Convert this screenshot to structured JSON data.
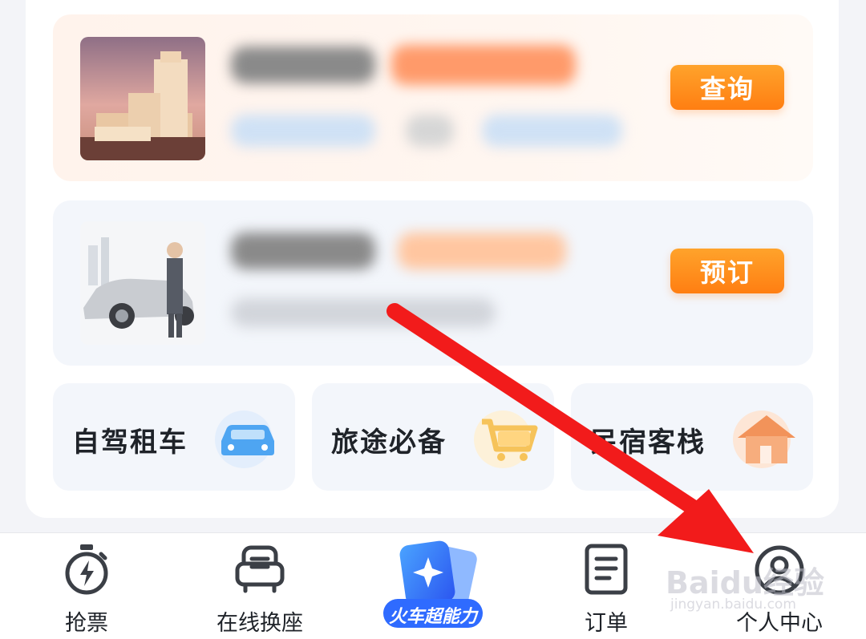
{
  "cards": {
    "hotel": {
      "button_label": "查询"
    },
    "car_service": {
      "button_label": "预订"
    }
  },
  "quick_tiles": [
    {
      "label": "自驾租车",
      "icon": "car-icon"
    },
    {
      "label": "旅途必备",
      "icon": "shopping-cart-icon"
    },
    {
      "label": "民宿客栈",
      "icon": "house-icon"
    }
  ],
  "tabbar": {
    "items": [
      {
        "label": "抢票",
        "icon": "stopwatch-lightning-icon"
      },
      {
        "label": "在线换座",
        "icon": "seat-icon"
      },
      {
        "label": "火车超能力",
        "icon": "star-cards-icon"
      },
      {
        "label": "订单",
        "icon": "document-icon"
      },
      {
        "label": "个人中心",
        "icon": "user-icon"
      }
    ]
  },
  "watermark": {
    "brand": "Baidu经验",
    "url": "jingyan.baidu.com"
  },
  "colors": {
    "accent_orange": "#ff8a1c",
    "annotation_red": "#f21b1b",
    "tab_blue": "#2f6bff"
  }
}
